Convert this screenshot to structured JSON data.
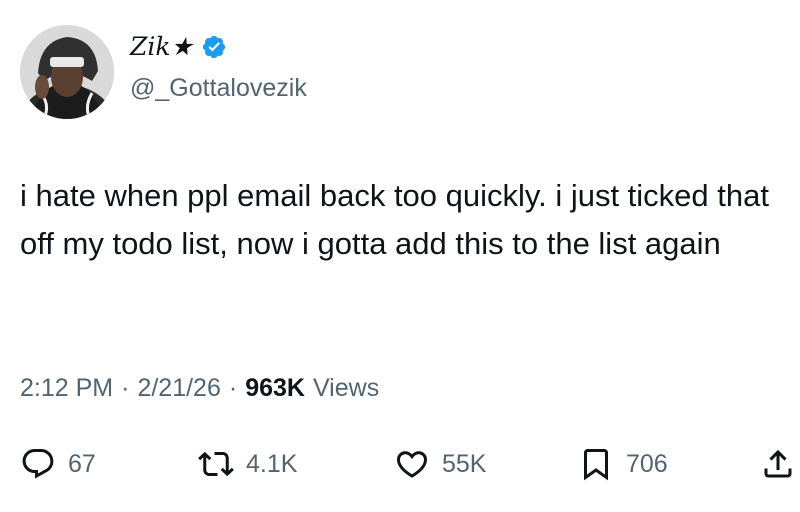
{
  "author": {
    "display_name": "Zik★",
    "handle": "@_Gottalovezik",
    "verified": true
  },
  "tweet": {
    "text": "i hate when ppl email back too quickly. i just ticked that off my todo list, now i gotta add this to the list again"
  },
  "meta": {
    "time": "2:12 PM",
    "separator": "·",
    "date": "2/21/26",
    "views_count": "963K",
    "views_label": "Views"
  },
  "actions": {
    "replies": "67",
    "retweets": "4.1K",
    "likes": "55K",
    "bookmarks": "706"
  },
  "icons": [
    "reply-icon",
    "retweet-icon",
    "like-icon",
    "bookmark-icon",
    "share-icon",
    "verified-badge-icon"
  ],
  "colors": {
    "text": "#0f1419",
    "secondary": "#536471",
    "verified": "#1d9bf0"
  }
}
